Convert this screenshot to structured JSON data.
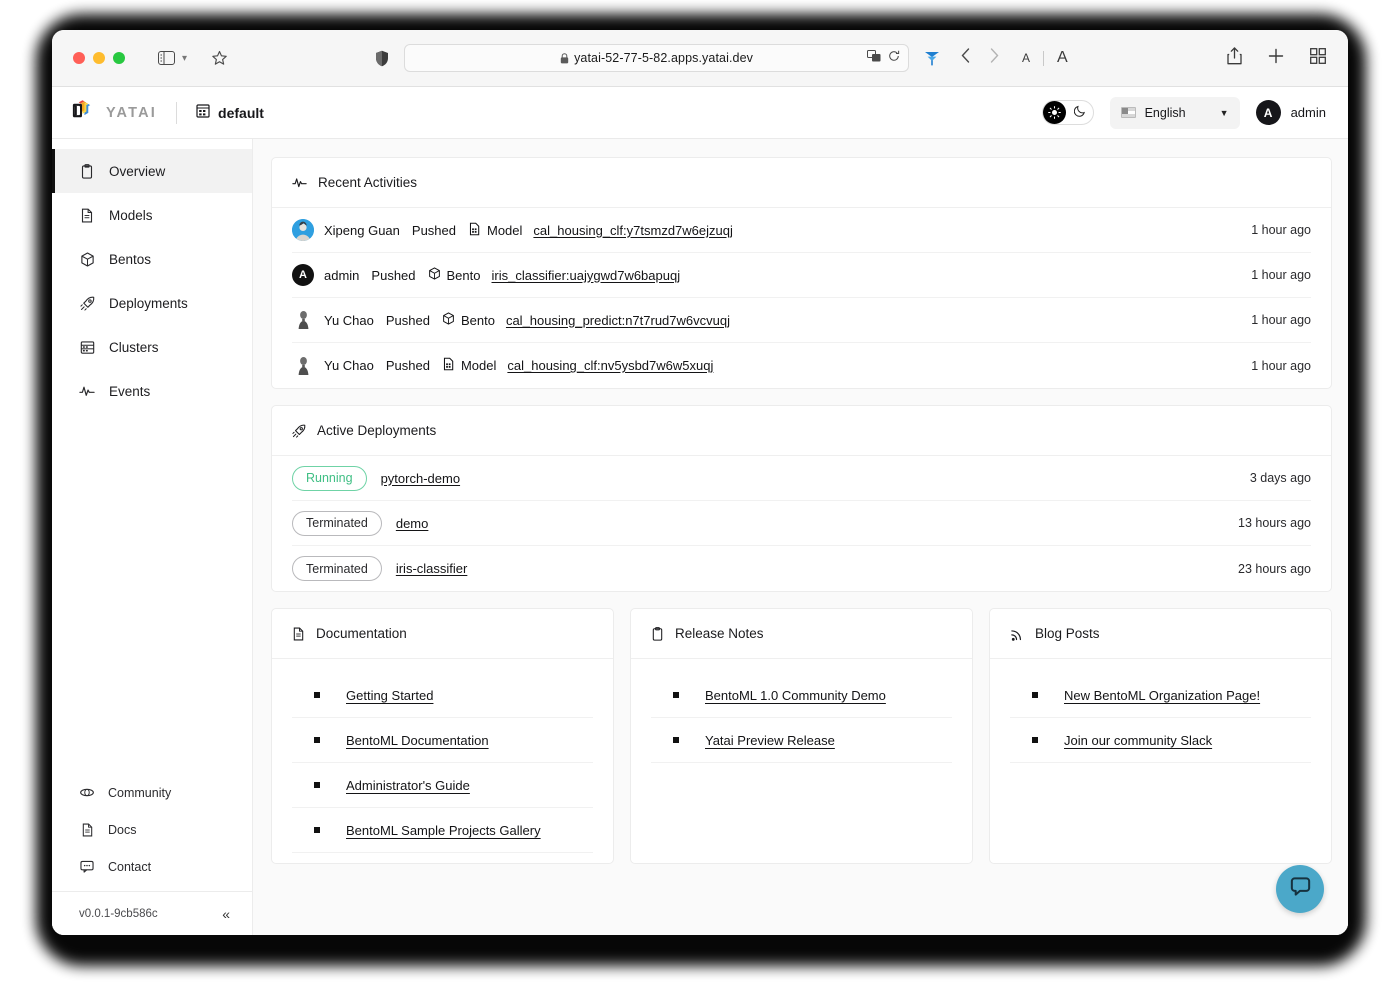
{
  "browser": {
    "url": "yatai-52-77-5-82.apps.yatai.dev",
    "sidebar_toggle_icon": "sidebar-icon",
    "chevron_icon": "chevron-down-icon",
    "bookmark_icon": "star-icon",
    "shield_icon": "shield-icon",
    "lock_icon": "lock-icon",
    "translate_icon": "translate-icon",
    "reload_icon": "reload-icon",
    "extension_icon": "extension-icon",
    "back_icon": "chevron-left-icon",
    "forward_icon": "chevron-right-icon",
    "text_small": "A",
    "text_large": "A",
    "share_icon": "share-icon",
    "new_tab_icon": "plus-icon",
    "tab_overview_icon": "grid-icon"
  },
  "header": {
    "brand": "YATAI",
    "org": "default",
    "language": "English",
    "user": "admin",
    "avatar_letter": "A",
    "theme": {
      "light_icon": "sun-icon",
      "dark_icon": "moon-icon"
    }
  },
  "sidebar": {
    "items": [
      {
        "label": "Overview",
        "icon": "clipboard-icon",
        "active": true
      },
      {
        "label": "Models",
        "icon": "document-icon",
        "active": false
      },
      {
        "label": "Bentos",
        "icon": "box-icon",
        "active": false
      },
      {
        "label": "Deployments",
        "icon": "rocket-icon",
        "active": false
      },
      {
        "label": "Clusters",
        "icon": "server-icon",
        "active": false
      },
      {
        "label": "Events",
        "icon": "activity-icon",
        "active": false
      }
    ],
    "bottom_items": [
      {
        "label": "Community",
        "icon": "community-icon"
      },
      {
        "label": "Docs",
        "icon": "docs-icon"
      },
      {
        "label": "Contact",
        "icon": "chat-icon"
      }
    ],
    "version": "v0.0.1-9cb586c",
    "collapse_icon": "double-chevron-left-icon"
  },
  "recent_activities": {
    "title": "Recent Activities",
    "icon": "activity-icon",
    "rows": [
      {
        "user": "Xipeng Guan",
        "verb": "Pushed",
        "kind": "Model",
        "kind_icon": "model-icon",
        "resource": "cal_housing_clf:y7tsmzd7w6ejzuqj",
        "time": "1 hour ago",
        "avatar": "photo"
      },
      {
        "user": "admin",
        "verb": "Pushed",
        "kind": "Bento",
        "kind_icon": "bento-icon",
        "resource": "iris_classifier:uajygwd7w6bapuqj",
        "time": "1 hour ago",
        "avatar": "letter"
      },
      {
        "user": "Yu Chao",
        "verb": "Pushed",
        "kind": "Bento",
        "kind_icon": "bento-icon",
        "resource": "cal_housing_predict:n7t7rud7w6vcvuqj",
        "time": "1 hour ago",
        "avatar": "gray"
      },
      {
        "user": "Yu Chao",
        "verb": "Pushed",
        "kind": "Model",
        "kind_icon": "model-icon",
        "resource": "cal_housing_clf:nv5ysbd7w6w5xuqj",
        "time": "1 hour ago",
        "avatar": "gray"
      }
    ]
  },
  "active_deployments": {
    "title": "Active Deployments",
    "icon": "rocket-icon",
    "rows": [
      {
        "status": "Running",
        "status_type": "running",
        "name": "pytorch-demo",
        "time": "3 days ago"
      },
      {
        "status": "Terminated",
        "status_type": "terminated",
        "name": "demo",
        "time": "13 hours ago"
      },
      {
        "status": "Terminated",
        "status_type": "terminated",
        "name": "iris-classifier",
        "time": "23 hours ago"
      }
    ]
  },
  "cards": [
    {
      "title": "Documentation",
      "icon": "document-icon",
      "links": [
        "Getting Started",
        "BentoML Documentation",
        "Administrator's Guide",
        "BentoML Sample Projects Gallery"
      ]
    },
    {
      "title": "Release Notes",
      "icon": "clipboard-icon",
      "links": [
        "BentoML 1.0 Community Demo",
        "Yatai Preview Release"
      ]
    },
    {
      "title": "Blog Posts",
      "icon": "rss-icon",
      "links": [
        "New BentoML Organization Page!",
        "Join our community Slack"
      ]
    }
  ],
  "chat_widget": {
    "icon": "chat-bubble-icon",
    "color": "#4ba8c9"
  },
  "colors": {
    "running": "#3fbf84",
    "terminated": "#2b2b2e",
    "accent": "#111111",
    "page_bg": "#fafafa"
  }
}
